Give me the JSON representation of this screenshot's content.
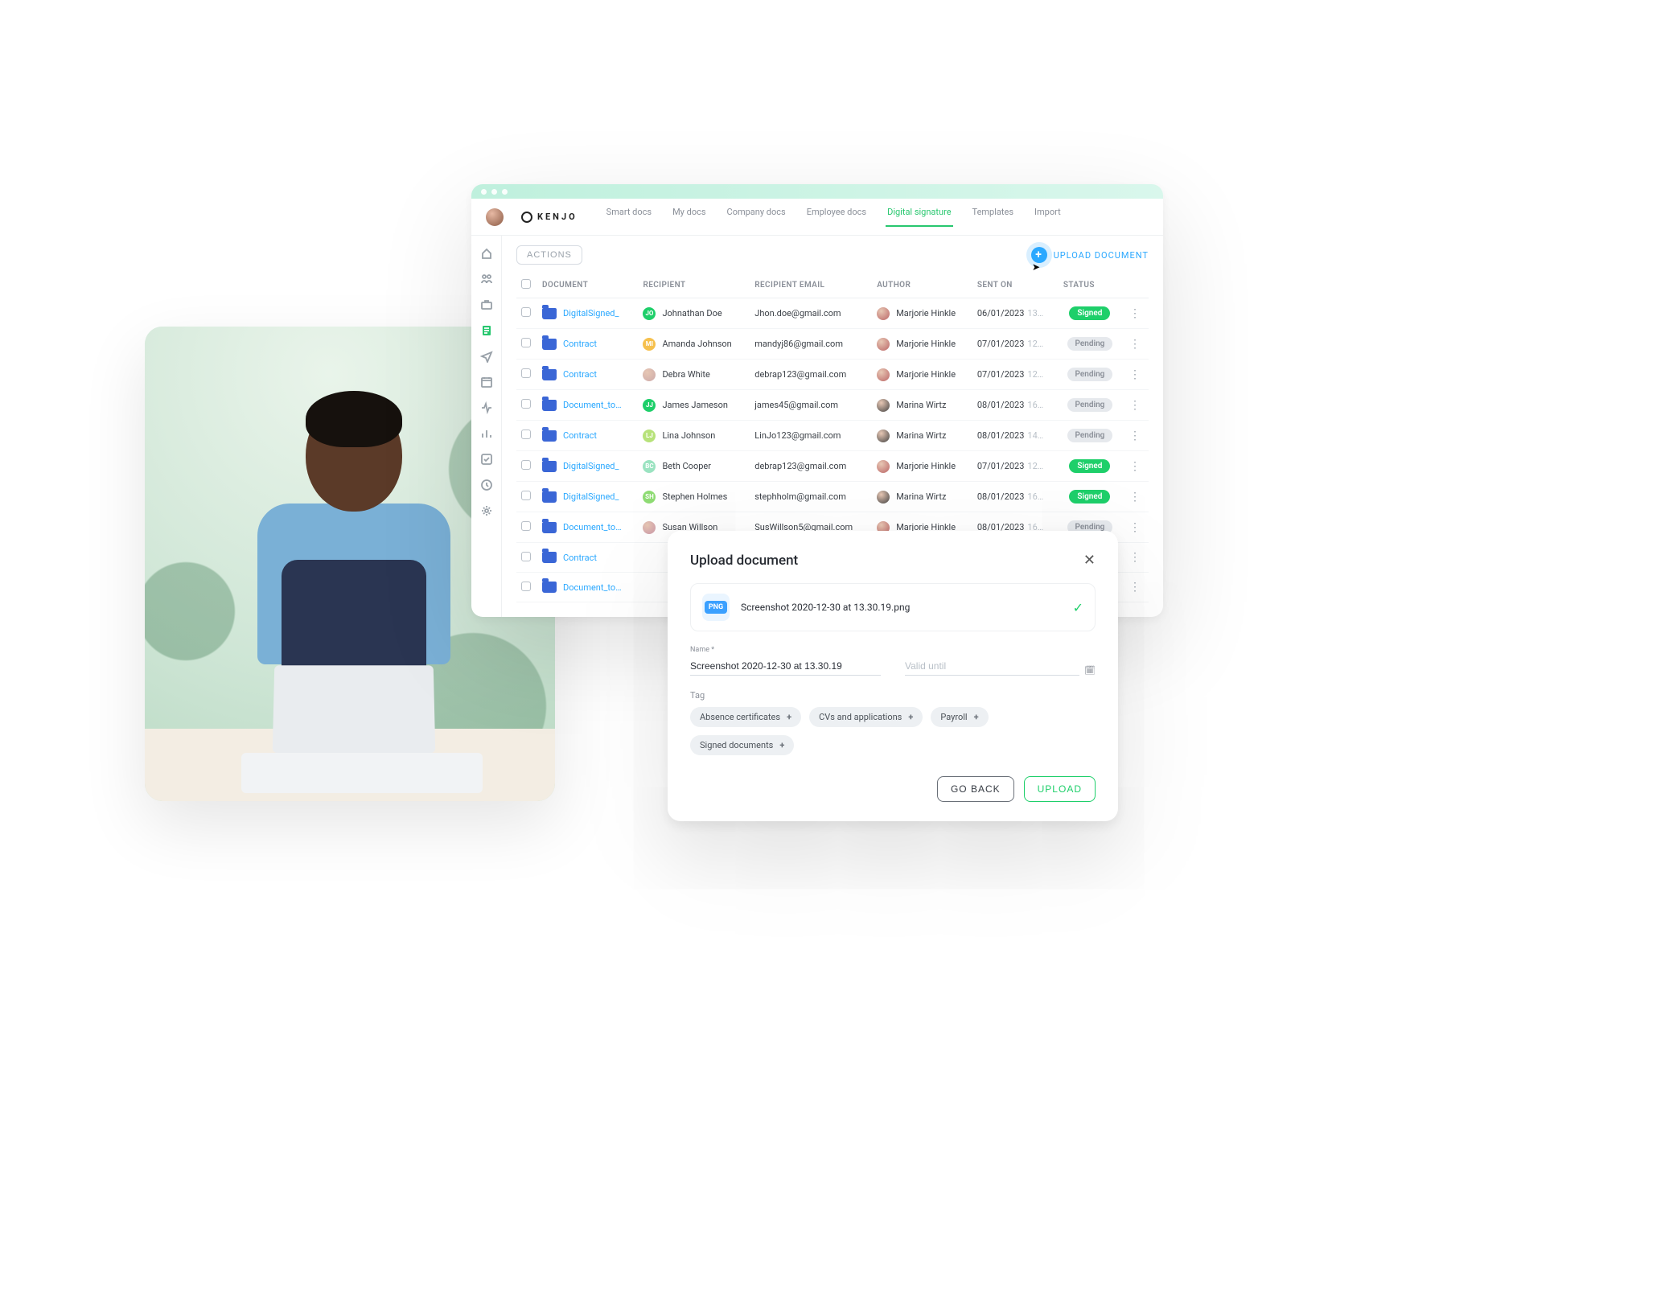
{
  "brand": "KENJO",
  "topbar": {
    "tabs": [
      "Smart docs",
      "My docs",
      "Company docs",
      "Employee docs",
      "Digital signature",
      "Templates",
      "Import"
    ],
    "active_tab_index": 4
  },
  "leftnav": {
    "items": [
      "home",
      "people",
      "briefcase",
      "docs",
      "plane",
      "calendar",
      "activity",
      "bar-chart",
      "checkbox",
      "clock",
      "gear"
    ],
    "active_index": 3
  },
  "toolbar": {
    "actions_label": "ACTIONS",
    "upload_label": "UPLOAD DOCUMENT"
  },
  "table": {
    "headers": [
      "DOCUMENT",
      "RECIPIENT",
      "RECIPIENT EMAIL",
      "AUTHOR",
      "SENT ON",
      "STATUS"
    ],
    "rows": [
      {
        "doc": "DigitalSigned_",
        "recipient": {
          "initials": "JO",
          "color": "#1ecf6a",
          "name": "Johnathan Doe"
        },
        "email": "Jhon.doe@gmail.com",
        "author": {
          "name": "Marjorie Hinkle",
          "color": "#b66"
        },
        "date": "06/01/2023",
        "time": "13…",
        "status": "Signed"
      },
      {
        "doc": "Contract",
        "recipient": {
          "initials": "MI",
          "color": "#f6c04d",
          "name": "Amanda Johnson"
        },
        "email": "mandyj86@gmail.com",
        "author": {
          "name": "Marjorie Hinkle",
          "color": "#b66"
        },
        "date": "07/01/2023",
        "time": "12…",
        "status": "Pending"
      },
      {
        "doc": "Contract",
        "recipient": {
          "initials": "",
          "color": "#caa",
          "name": "Debra White",
          "photo": true
        },
        "email": "debrap123@gmail.com",
        "author": {
          "name": "Marjorie Hinkle",
          "color": "#b66"
        },
        "date": "07/01/2023",
        "time": "12…",
        "status": "Pending"
      },
      {
        "doc": "Document_to…",
        "recipient": {
          "initials": "JJ",
          "color": "#1ecf6a",
          "name": "James Jameson"
        },
        "email": "james45@gmail.com",
        "author": {
          "name": "Marina Wirtz",
          "color": "#444",
          "photo": true
        },
        "date": "08/01/2023",
        "time": "16…",
        "status": "Pending"
      },
      {
        "doc": "Contract",
        "recipient": {
          "initials": "LJ",
          "color": "#b7e27a",
          "name": "Lina Johnson"
        },
        "email": "LinJo123@gmail.com",
        "author": {
          "name": "Marina Wirtz",
          "color": "#444",
          "photo": true
        },
        "date": "08/01/2023",
        "time": "14…",
        "status": "Pending"
      },
      {
        "doc": "DigitalSigned_",
        "recipient": {
          "initials": "BC",
          "color": "#9be3c1",
          "name": "Beth Cooper"
        },
        "email": "debrap123@gmail.com",
        "author": {
          "name": "Marjorie Hinkle",
          "color": "#b66"
        },
        "date": "07/01/2023",
        "time": "12…",
        "status": "Signed"
      },
      {
        "doc": "DigitalSigned_",
        "recipient": {
          "initials": "SH",
          "color": "#8fdc74",
          "name": "Stephen Holmes"
        },
        "email": "stephholm@gmail.com",
        "author": {
          "name": "Marina Wirtz",
          "color": "#444",
          "photo": true
        },
        "date": "08/01/2023",
        "time": "16…",
        "status": "Signed"
      },
      {
        "doc": "Document_to…",
        "recipient": {
          "initials": "",
          "color": "#c9a",
          "name": "Susan Willson",
          "photo": true
        },
        "email": "SusWillson5@gmail.com",
        "author": {
          "name": "Marjorie Hinkle",
          "color": "#b66"
        },
        "date": "08/01/2023",
        "time": "16…",
        "status": "Pending"
      },
      {
        "doc": "Contract",
        "recipient": null,
        "email": "",
        "author": null,
        "date": "",
        "time": "",
        "status": ""
      },
      {
        "doc": "Document_to…",
        "recipient": null,
        "email": "",
        "author": null,
        "date": "",
        "time": "",
        "status": ""
      }
    ]
  },
  "modal": {
    "title": "Upload document",
    "file_badge": "PNG",
    "file_name": "Screenshot 2020-12-30 at 13.30.19.png",
    "name_label": "Name *",
    "name_value": "Screenshot 2020-12-30 at 13.30.19",
    "valid_label": "Valid until",
    "valid_placeholder": "Valid until",
    "tag_label": "Tag",
    "tags": [
      "Absence certificates",
      "CVs and applications",
      "Payroll",
      "Signed documents"
    ],
    "go_back": "GO BACK",
    "upload": "UPLOAD"
  }
}
